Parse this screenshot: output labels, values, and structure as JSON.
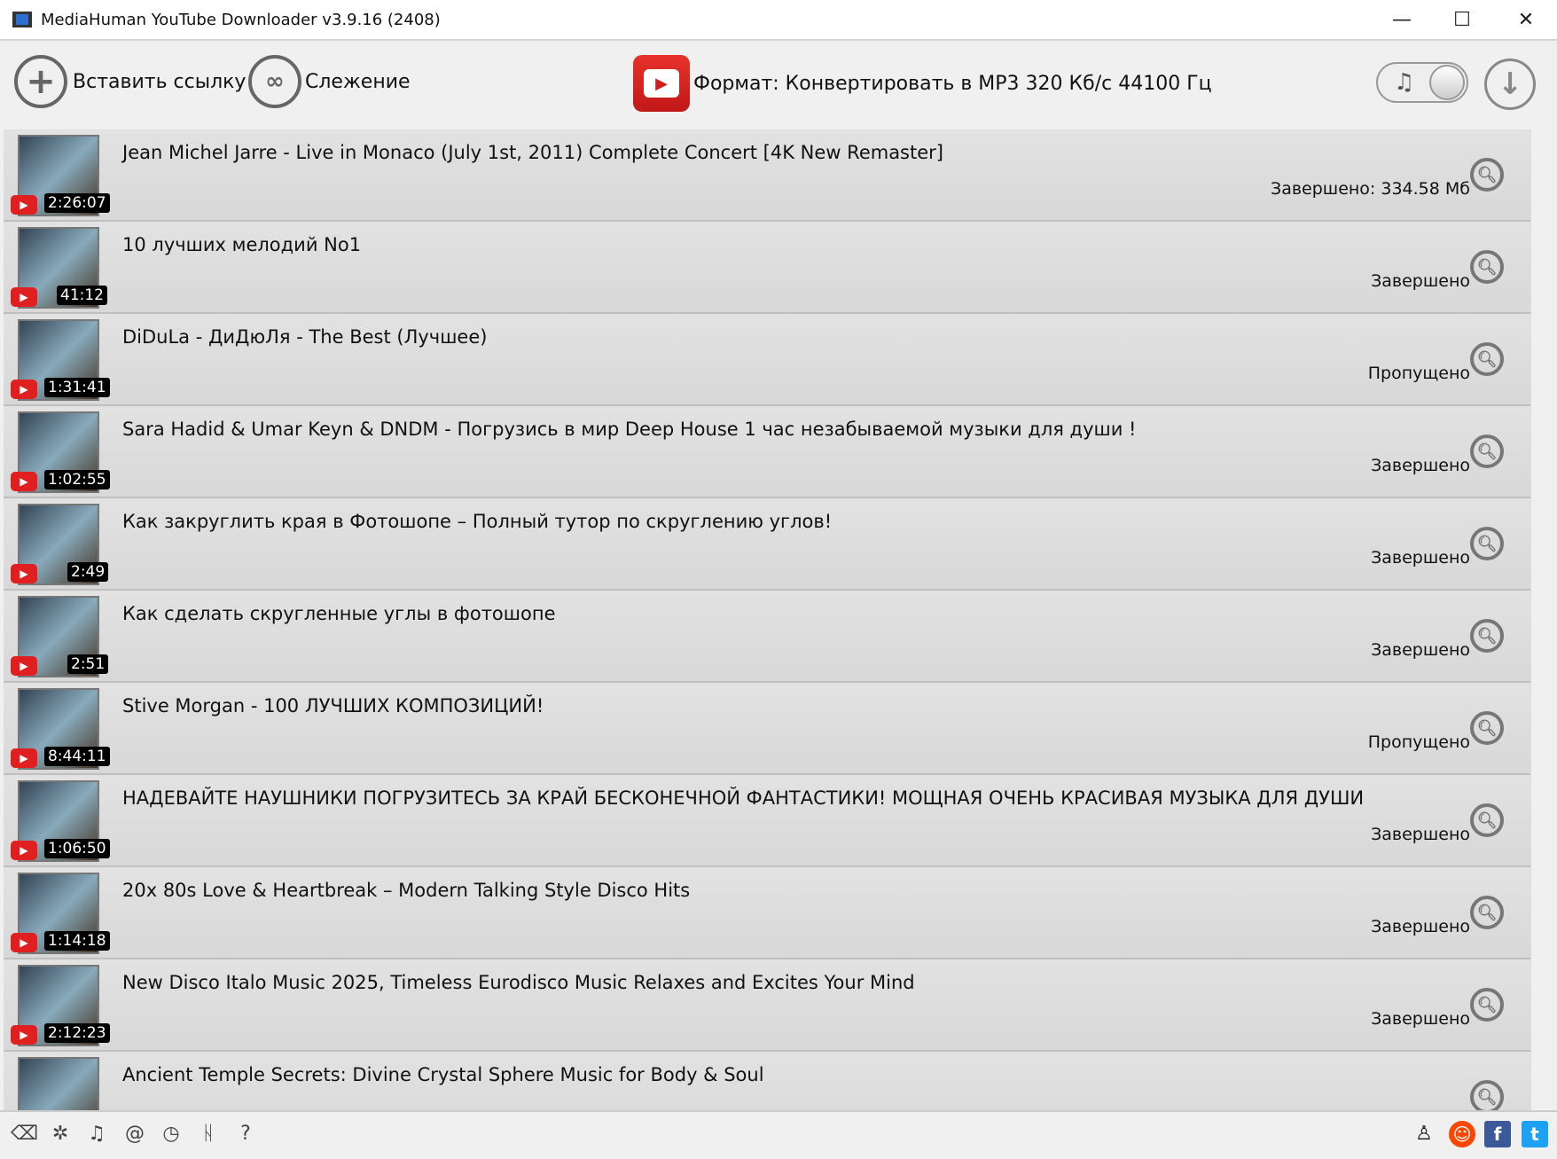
{
  "window": {
    "title": "MediaHuman YouTube Downloader v3.9.16 (2408)"
  },
  "toolbar": {
    "paste_label": "Вставить ссылку",
    "tracking_label": "Слежение",
    "format_label": "Формат: Конвертировать в MP3 320 Кб/с 44100 Гц",
    "audio_toggle_on": false
  },
  "items": [
    {
      "title": "Jean Michel Jarre - Live in Monaco (July 1st, 2011) Complete Concert [4K New Remaster]",
      "duration": "2:26:07",
      "status": "Завершено: 334.58 Мб"
    },
    {
      "title": "10 лучших мелодий No1",
      "duration": "41:12",
      "status": "Завершено"
    },
    {
      "title": "DiDuLa - ДиДюЛя - The Best (Лучшее)",
      "duration": "1:31:41",
      "status": "Пропущено"
    },
    {
      "title": "Sara Hadid & Umar Keyn & DNDM - Погрузись в мир Deep House 1 час незабываемой музыки для души !",
      "duration": "1:02:55",
      "status": "Завершено"
    },
    {
      "title": "Как закруглить края в Фотошопе – Полный тутор по скруглению углов!",
      "duration": "2:49",
      "status": "Завершено"
    },
    {
      "title": "Как сделать скругленные углы в фотошопе",
      "duration": "2:51",
      "status": "Завершено"
    },
    {
      "title": "Stive Morgan - 100 ЛУЧШИХ КОМПОЗИЦИЙ!",
      "duration": "8:44:11",
      "status": "Пропущено"
    },
    {
      "title": "НАДЕВАЙТЕ НАУШНИКИ ПОГРУЗИТЕСЬ ЗА КРАЙ БЕСКОНЕЧНОЙ ФАНТАСТИКИ! МОЩНАЯ ОЧЕНЬ КРАСИВАЯ МУЗЫКА ДЛЯ ДУШИ",
      "duration": "1:06:50",
      "status": "Завершено"
    },
    {
      "title": "20x 80s Love & Heartbreak – Modern Talking Style Disco Hits",
      "duration": "1:14:18",
      "status": "Завершено"
    },
    {
      "title": "New Disco Italo Music 2025, Timeless Eurodisco Music Relaxes and Excites Your Mind",
      "duration": "2:12:23",
      "status": "Завершено"
    },
    {
      "title": "Ancient Temple Secrets: Divine Crystal Sphere Music for Body & Soul",
      "duration": "",
      "status": ""
    }
  ],
  "statusbar": {
    "icons": [
      "broom-icon",
      "gear-icon",
      "music-note-icon",
      "snail-icon",
      "clock-icon",
      "binoculars-icon",
      "help-icon"
    ],
    "social": [
      "agent-icon",
      "reddit-icon",
      "facebook-icon",
      "twitter-icon"
    ]
  },
  "colors": {
    "accent_red": "#e02020",
    "reddit": "#ff4500",
    "facebook": "#3b5998",
    "twitter": "#1da1f2"
  }
}
